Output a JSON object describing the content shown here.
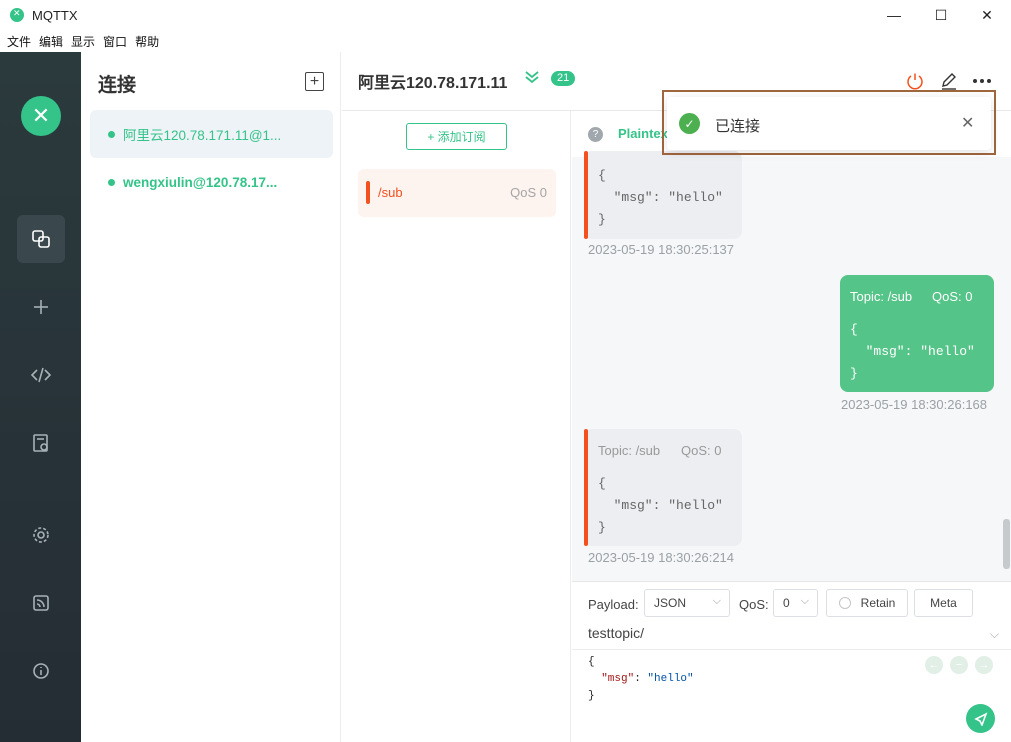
{
  "window": {
    "title": "MQTTX",
    "minimize": "—",
    "maximize": "☐",
    "close": "✕"
  },
  "menu": [
    "文件",
    "编辑",
    "显示",
    "窗口",
    "帮助"
  ],
  "connections": {
    "heading": "连接",
    "add_symbol": "+",
    "items": [
      {
        "label": "阿里云120.78.171.11@1..."
      },
      {
        "label": "wengxiulin@120.78.17..."
      }
    ]
  },
  "header": {
    "name": "阿里云120.78.171.11",
    "chevron": "≫",
    "badge": "21"
  },
  "subscriptions": {
    "add_label": "+ 添加订阅",
    "items": [
      {
        "topic": "/sub",
        "qos": "QoS 0"
      }
    ]
  },
  "message_toolbar": {
    "help": "?",
    "payload_type": "Plaintex"
  },
  "messages": [
    {
      "direction": "in",
      "code": "{\n  \"msg\": \"hello\"\n}",
      "time": "2023-05-19 18:30:25:137"
    },
    {
      "direction": "out",
      "topic": "Topic: /sub",
      "qos": "QoS: 0",
      "code": "{\n  \"msg\": \"hello\"\n}",
      "time": "2023-05-19 18:30:26:168"
    },
    {
      "direction": "in",
      "topic": "Topic: /sub",
      "qos": "QoS: 0",
      "code": "{\n  \"msg\": \"hello\"\n}",
      "time": "2023-05-19 18:30:26:214"
    }
  ],
  "publish": {
    "payload_label": "Payload:",
    "payload_format": "JSON",
    "qos_label": "QoS:",
    "qos_value": "0",
    "retain_label": "Retain",
    "meta_label": "Meta",
    "topic": "testtopic/",
    "code_open": "{",
    "code_key": "\"msg\"",
    "code_colon": ": ",
    "code_value": "\"hello\"",
    "code_close": "}"
  },
  "toast": {
    "text": "已连接",
    "close": "✕"
  },
  "colors": {
    "accent": "#34c388",
    "sub_topic": "#f4511e",
    "rail": "#2b3a3c"
  }
}
